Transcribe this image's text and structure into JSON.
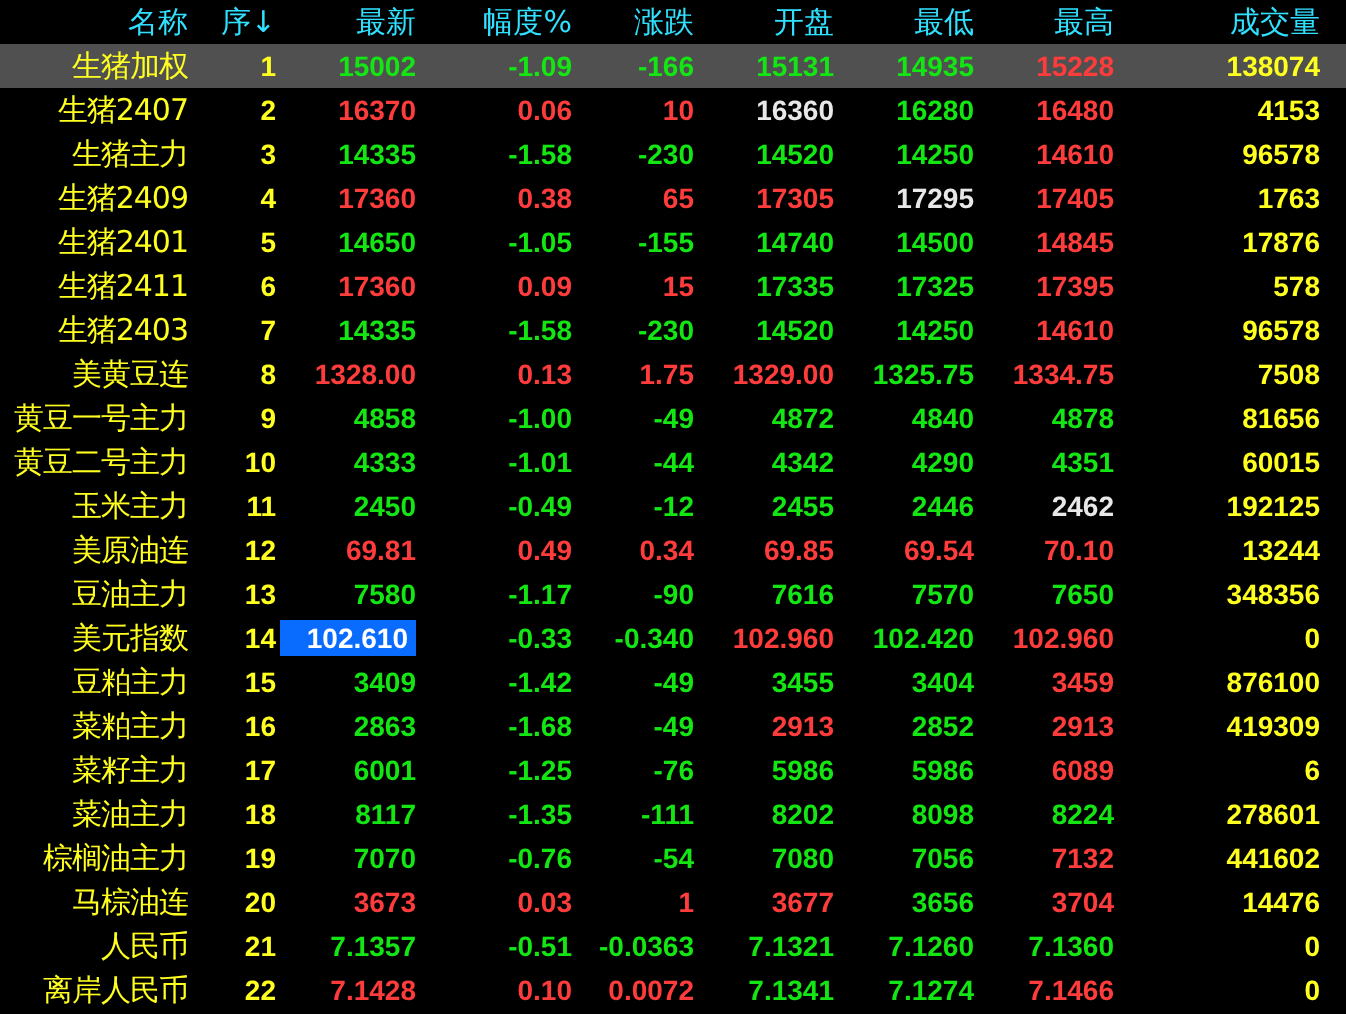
{
  "columns": [
    "名称",
    "序↓",
    "最新",
    "幅度%",
    "涨跌",
    "开盘",
    "最低",
    "最高",
    "成交量"
  ],
  "rows": [
    {
      "name": "生猪加权",
      "seq": "1",
      "selected": true,
      "cursor": false,
      "cells": [
        {
          "text": "15002",
          "color": "#14e614"
        },
        {
          "text": "-1.09",
          "color": "#14e614"
        },
        {
          "text": "-166",
          "color": "#14e614"
        },
        {
          "text": "15131",
          "color": "#14e614"
        },
        {
          "text": "14935",
          "color": "#14e614"
        },
        {
          "text": "15228",
          "color": "#ff3c3c"
        }
      ],
      "volume": "138074"
    },
    {
      "name": "生猪2407",
      "seq": "2",
      "selected": false,
      "cursor": false,
      "cells": [
        {
          "text": "16370",
          "color": "#ff3c3c"
        },
        {
          "text": "0.06",
          "color": "#ff3c3c"
        },
        {
          "text": "10",
          "color": "#ff3c3c"
        },
        {
          "text": "16360",
          "color": "#e8e8e8"
        },
        {
          "text": "16280",
          "color": "#14e614"
        },
        {
          "text": "16480",
          "color": "#ff3c3c"
        }
      ],
      "volume": "4153"
    },
    {
      "name": "生猪主力",
      "seq": "3",
      "selected": false,
      "cursor": false,
      "cells": [
        {
          "text": "14335",
          "color": "#14e614"
        },
        {
          "text": "-1.58",
          "color": "#14e614"
        },
        {
          "text": "-230",
          "color": "#14e614"
        },
        {
          "text": "14520",
          "color": "#14e614"
        },
        {
          "text": "14250",
          "color": "#14e614"
        },
        {
          "text": "14610",
          "color": "#ff3c3c"
        }
      ],
      "volume": "96578"
    },
    {
      "name": "生猪2409",
      "seq": "4",
      "selected": false,
      "cursor": false,
      "cells": [
        {
          "text": "17360",
          "color": "#ff3c3c"
        },
        {
          "text": "0.38",
          "color": "#ff3c3c"
        },
        {
          "text": "65",
          "color": "#ff3c3c"
        },
        {
          "text": "17305",
          "color": "#ff3c3c"
        },
        {
          "text": "17295",
          "color": "#e8e8e8"
        },
        {
          "text": "17405",
          "color": "#ff3c3c"
        }
      ],
      "volume": "1763"
    },
    {
      "name": "生猪2401",
      "seq": "5",
      "selected": false,
      "cursor": false,
      "cells": [
        {
          "text": "14650",
          "color": "#14e614"
        },
        {
          "text": "-1.05",
          "color": "#14e614"
        },
        {
          "text": "-155",
          "color": "#14e614"
        },
        {
          "text": "14740",
          "color": "#14e614"
        },
        {
          "text": "14500",
          "color": "#14e614"
        },
        {
          "text": "14845",
          "color": "#ff3c3c"
        }
      ],
      "volume": "17876"
    },
    {
      "name": "生猪2411",
      "seq": "6",
      "selected": false,
      "cursor": false,
      "cells": [
        {
          "text": "17360",
          "color": "#ff3c3c"
        },
        {
          "text": "0.09",
          "color": "#ff3c3c"
        },
        {
          "text": "15",
          "color": "#ff3c3c"
        },
        {
          "text": "17335",
          "color": "#14e614"
        },
        {
          "text": "17325",
          "color": "#14e614"
        },
        {
          "text": "17395",
          "color": "#ff3c3c"
        }
      ],
      "volume": "578"
    },
    {
      "name": "生猪2403",
      "seq": "7",
      "selected": false,
      "cursor": false,
      "cells": [
        {
          "text": "14335",
          "color": "#14e614"
        },
        {
          "text": "-1.58",
          "color": "#14e614"
        },
        {
          "text": "-230",
          "color": "#14e614"
        },
        {
          "text": "14520",
          "color": "#14e614"
        },
        {
          "text": "14250",
          "color": "#14e614"
        },
        {
          "text": "14610",
          "color": "#ff3c3c"
        }
      ],
      "volume": "96578"
    },
    {
      "name": "美黄豆连",
      "seq": "8",
      "selected": false,
      "cursor": false,
      "cells": [
        {
          "text": "1328.00",
          "color": "#ff3c3c"
        },
        {
          "text": "0.13",
          "color": "#ff3c3c"
        },
        {
          "text": "1.75",
          "color": "#ff3c3c"
        },
        {
          "text": "1329.00",
          "color": "#ff3c3c"
        },
        {
          "text": "1325.75",
          "color": "#14e614"
        },
        {
          "text": "1334.75",
          "color": "#ff3c3c"
        }
      ],
      "volume": "7508"
    },
    {
      "name": "黄豆一号主力",
      "seq": "9",
      "selected": false,
      "cursor": false,
      "cells": [
        {
          "text": "4858",
          "color": "#14e614"
        },
        {
          "text": "-1.00",
          "color": "#14e614"
        },
        {
          "text": "-49",
          "color": "#14e614"
        },
        {
          "text": "4872",
          "color": "#14e614"
        },
        {
          "text": "4840",
          "color": "#14e614"
        },
        {
          "text": "4878",
          "color": "#14e614"
        }
      ],
      "volume": "81656"
    },
    {
      "name": "黄豆二号主力",
      "seq": "10",
      "selected": false,
      "cursor": false,
      "cells": [
        {
          "text": "4333",
          "color": "#14e614"
        },
        {
          "text": "-1.01",
          "color": "#14e614"
        },
        {
          "text": "-44",
          "color": "#14e614"
        },
        {
          "text": "4342",
          "color": "#14e614"
        },
        {
          "text": "4290",
          "color": "#14e614"
        },
        {
          "text": "4351",
          "color": "#14e614"
        }
      ],
      "volume": "60015"
    },
    {
      "name": "玉米主力",
      "seq": "11",
      "selected": false,
      "cursor": false,
      "cells": [
        {
          "text": "2450",
          "color": "#14e614"
        },
        {
          "text": "-0.49",
          "color": "#14e614"
        },
        {
          "text": "-12",
          "color": "#14e614"
        },
        {
          "text": "2455",
          "color": "#14e614"
        },
        {
          "text": "2446",
          "color": "#14e614"
        },
        {
          "text": "2462",
          "color": "#e8e8e8"
        }
      ],
      "volume": "192125"
    },
    {
      "name": "美原油连",
      "seq": "12",
      "selected": false,
      "cursor": false,
      "cells": [
        {
          "text": "69.81",
          "color": "#ff3c3c"
        },
        {
          "text": "0.49",
          "color": "#ff3c3c"
        },
        {
          "text": "0.34",
          "color": "#ff3c3c"
        },
        {
          "text": "69.85",
          "color": "#ff3c3c"
        },
        {
          "text": "69.54",
          "color": "#ff3c3c"
        },
        {
          "text": "70.10",
          "color": "#ff3c3c"
        }
      ],
      "volume": "13244"
    },
    {
      "name": "豆油主力",
      "seq": "13",
      "selected": false,
      "cursor": false,
      "cells": [
        {
          "text": "7580",
          "color": "#14e614"
        },
        {
          "text": "-1.17",
          "color": "#14e614"
        },
        {
          "text": "-90",
          "color": "#14e614"
        },
        {
          "text": "7616",
          "color": "#14e614"
        },
        {
          "text": "7570",
          "color": "#14e614"
        },
        {
          "text": "7650",
          "color": "#14e614"
        }
      ],
      "volume": "348356"
    },
    {
      "name": "美元指数",
      "seq": "14",
      "selected": false,
      "cursor": true,
      "cells": [
        {
          "text": "102.610"
        },
        {
          "text": "-0.33",
          "color": "#14e614"
        },
        {
          "text": "-0.340",
          "color": "#14e614"
        },
        {
          "text": "102.960",
          "color": "#ff3c3c"
        },
        {
          "text": "102.420",
          "color": "#14e614"
        },
        {
          "text": "102.960",
          "color": "#ff3c3c"
        }
      ],
      "volume": "0"
    },
    {
      "name": "豆粕主力",
      "seq": "15",
      "selected": false,
      "cursor": false,
      "cells": [
        {
          "text": "3409",
          "color": "#14e614"
        },
        {
          "text": "-1.42",
          "color": "#14e614"
        },
        {
          "text": "-49",
          "color": "#14e614"
        },
        {
          "text": "3455",
          "color": "#14e614"
        },
        {
          "text": "3404",
          "color": "#14e614"
        },
        {
          "text": "3459",
          "color": "#ff3c3c"
        }
      ],
      "volume": "876100"
    },
    {
      "name": "菜粕主力",
      "seq": "16",
      "selected": false,
      "cursor": false,
      "cells": [
        {
          "text": "2863",
          "color": "#14e614"
        },
        {
          "text": "-1.68",
          "color": "#14e614"
        },
        {
          "text": "-49",
          "color": "#14e614"
        },
        {
          "text": "2913",
          "color": "#ff3c3c"
        },
        {
          "text": "2852",
          "color": "#14e614"
        },
        {
          "text": "2913",
          "color": "#ff3c3c"
        }
      ],
      "volume": "419309"
    },
    {
      "name": "菜籽主力",
      "seq": "17",
      "selected": false,
      "cursor": false,
      "cells": [
        {
          "text": "6001",
          "color": "#14e614"
        },
        {
          "text": "-1.25",
          "color": "#14e614"
        },
        {
          "text": "-76",
          "color": "#14e614"
        },
        {
          "text": "5986",
          "color": "#14e614"
        },
        {
          "text": "5986",
          "color": "#14e614"
        },
        {
          "text": "6089",
          "color": "#ff3c3c"
        }
      ],
      "volume": "6"
    },
    {
      "name": "菜油主力",
      "seq": "18",
      "selected": false,
      "cursor": false,
      "cells": [
        {
          "text": "8117",
          "color": "#14e614"
        },
        {
          "text": "-1.35",
          "color": "#14e614"
        },
        {
          "text": "-111",
          "color": "#14e614"
        },
        {
          "text": "8202",
          "color": "#14e614"
        },
        {
          "text": "8098",
          "color": "#14e614"
        },
        {
          "text": "8224",
          "color": "#14e614"
        }
      ],
      "volume": "278601"
    },
    {
      "name": "棕榈油主力",
      "seq": "19",
      "selected": false,
      "cursor": false,
      "cells": [
        {
          "text": "7070",
          "color": "#14e614"
        },
        {
          "text": "-0.76",
          "color": "#14e614"
        },
        {
          "text": "-54",
          "color": "#14e614"
        },
        {
          "text": "7080",
          "color": "#14e614"
        },
        {
          "text": "7056",
          "color": "#14e614"
        },
        {
          "text": "7132",
          "color": "#ff3c3c"
        }
      ],
      "volume": "441602"
    },
    {
      "name": "马棕油连",
      "seq": "20",
      "selected": false,
      "cursor": false,
      "cells": [
        {
          "text": "3673",
          "color": "#ff3c3c"
        },
        {
          "text": "0.03",
          "color": "#ff3c3c"
        },
        {
          "text": "1",
          "color": "#ff3c3c"
        },
        {
          "text": "3677",
          "color": "#ff3c3c"
        },
        {
          "text": "3656",
          "color": "#14e614"
        },
        {
          "text": "3704",
          "color": "#ff3c3c"
        }
      ],
      "volume": "14476"
    },
    {
      "name": "人民币",
      "seq": "21",
      "selected": false,
      "cursor": false,
      "cells": [
        {
          "text": "7.1357",
          "color": "#14e614"
        },
        {
          "text": "-0.51",
          "color": "#14e614"
        },
        {
          "text": "-0.0363",
          "color": "#14e614"
        },
        {
          "text": "7.1321",
          "color": "#14e614"
        },
        {
          "text": "7.1260",
          "color": "#14e614"
        },
        {
          "text": "7.1360",
          "color": "#14e614"
        }
      ],
      "volume": "0"
    },
    {
      "name": "离岸人民币",
      "seq": "22",
      "selected": false,
      "cursor": false,
      "cells": [
        {
          "text": "7.1428",
          "color": "#ff3c3c"
        },
        {
          "text": "0.10",
          "color": "#ff3c3c"
        },
        {
          "text": "0.0072",
          "color": "#ff3c3c"
        },
        {
          "text": "7.1341",
          "color": "#14e614"
        },
        {
          "text": "7.1274",
          "color": "#14e614"
        },
        {
          "text": "7.1466",
          "color": "#ff3c3c"
        }
      ],
      "volume": "0"
    }
  ]
}
